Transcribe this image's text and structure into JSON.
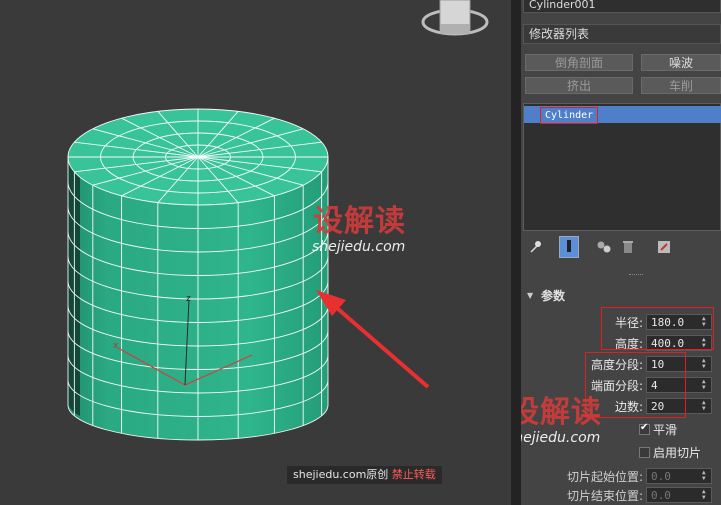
{
  "object_name": "Cylinder001",
  "modifier_list": "修改器列表",
  "modifier_buttons": {
    "bevel_profile": "倒角剖面",
    "noise": "噪波",
    "extrude": "挤出",
    "lathe": "车削"
  },
  "stack": {
    "selected": "Cylinder"
  },
  "rollout": {
    "title": "参数"
  },
  "params": {
    "radius_label": "半径:",
    "radius_value": "180.0",
    "height_label": "高度:",
    "height_value": "400.0",
    "height_segs_label": "高度分段:",
    "height_segs_value": "10",
    "cap_segs_label": "端面分段:",
    "cap_segs_value": "4",
    "sides_label": "边数:",
    "sides_value": "20",
    "smooth_label": "平滑",
    "smooth_checked": true,
    "slice_on_label": "启用切片",
    "slice_on_checked": false,
    "slice_from_label": "切片起始位置:",
    "slice_from_value": "0.0",
    "slice_to_label": "切片结束位置:",
    "slice_to_value": "0.0"
  },
  "watermark": {
    "cn": "设解读",
    "en": "shejiedu.com",
    "caption_site": "shejiedu.com原创",
    "caption_note": "禁止转载"
  },
  "colors": {
    "mesh_fill": "#2aa982",
    "selection": "#4f7fc8",
    "highlight_box": "#e02020",
    "arrow": "#e83030"
  }
}
